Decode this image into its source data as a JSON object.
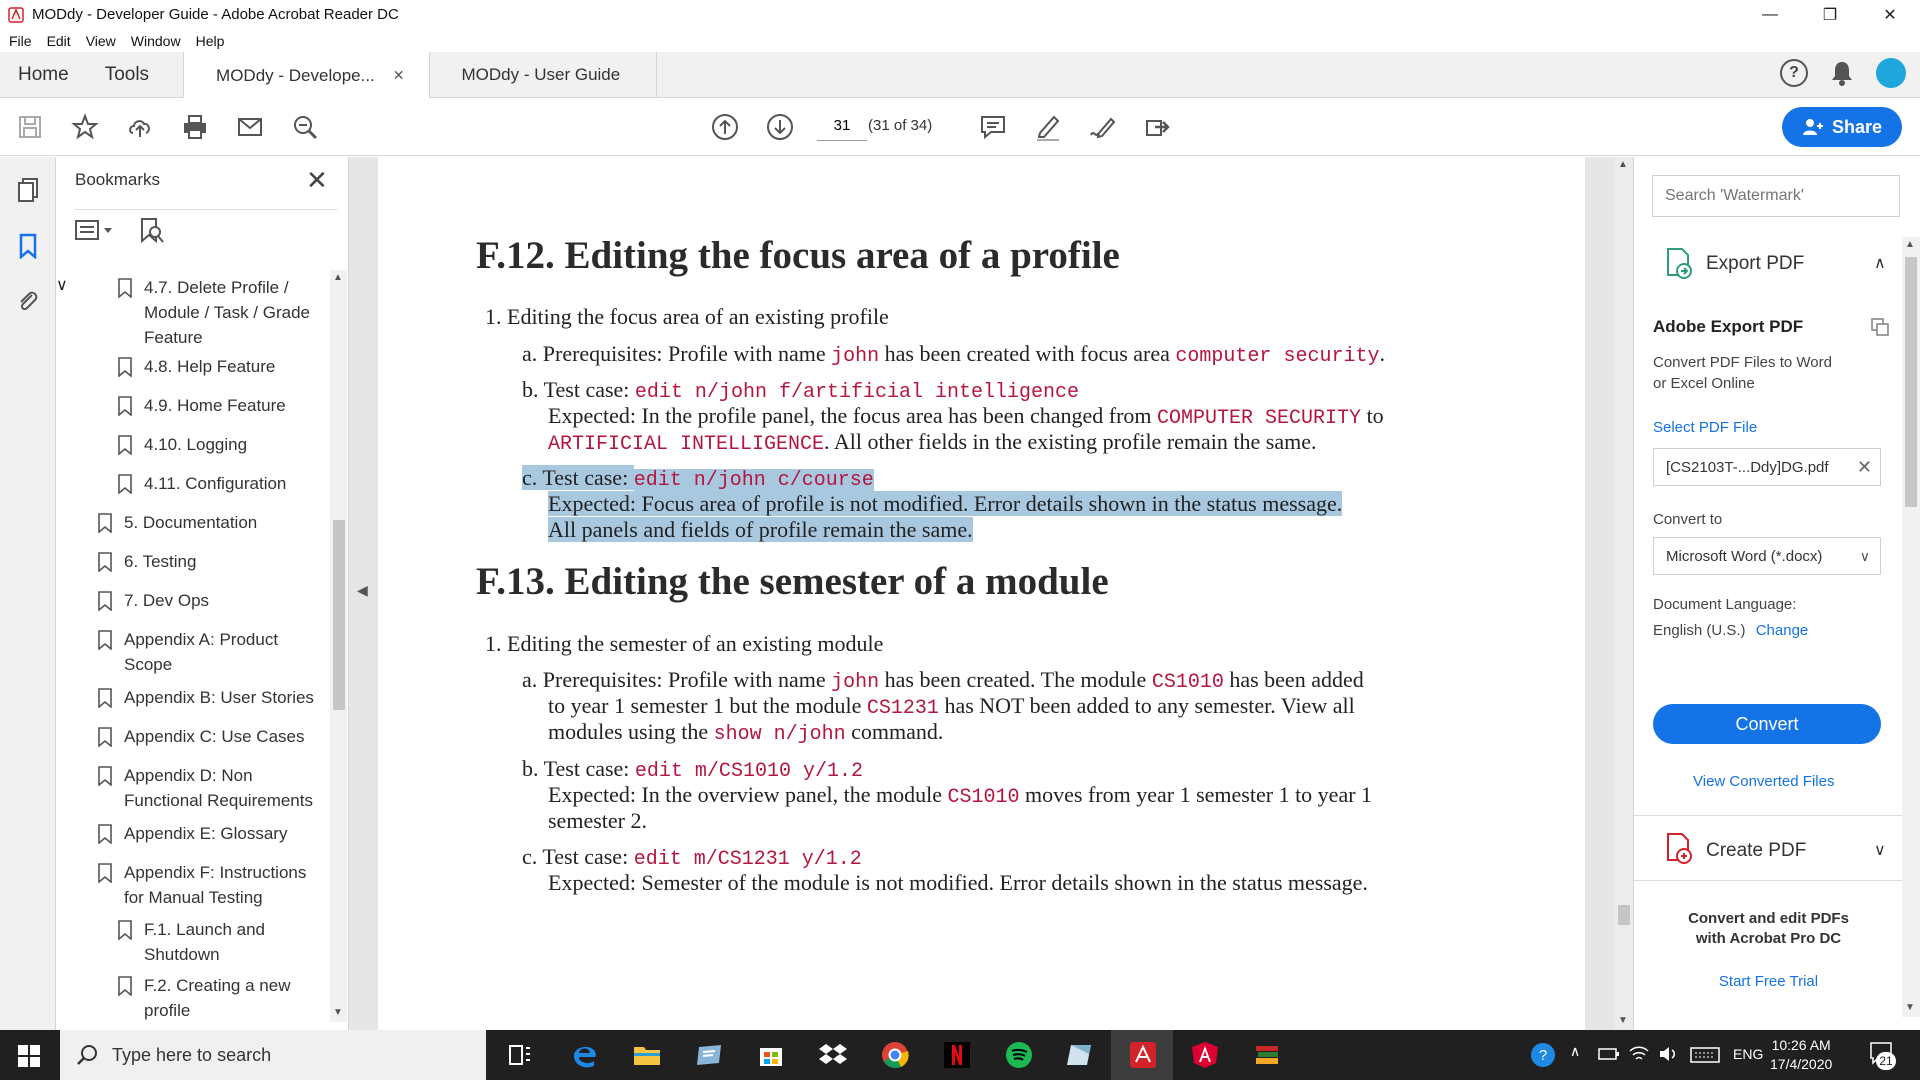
{
  "window": {
    "title": "MODdy - Developer Guide - Adobe Acrobat Reader DC"
  },
  "menu": {
    "items": [
      "File",
      "Edit",
      "View",
      "Window",
      "Help"
    ]
  },
  "tabs": {
    "home": "Home",
    "tools": "Tools",
    "doc_tabs": [
      {
        "label": "MODdy - Develope...",
        "active": true
      },
      {
        "label": "MODdy - User Guide",
        "active": false
      }
    ]
  },
  "toolbar": {
    "page_value": "31",
    "page_count": "(31 of 34)",
    "share_label": "Share"
  },
  "bookmarks": {
    "title": "Bookmarks",
    "items": [
      {
        "label": "4.7. Delete Profile / Module / Task / Grade Feature"
      },
      {
        "label": "4.8. Help Feature"
      },
      {
        "label": "4.9. Home Feature"
      },
      {
        "label": "4.10. Logging"
      },
      {
        "label": "4.11. Configuration"
      },
      {
        "label": "5. Documentation"
      },
      {
        "label": "6. Testing"
      },
      {
        "label": "7. Dev Ops"
      },
      {
        "label": "Appendix A: Product Scope"
      },
      {
        "label": "Appendix B: User Stories"
      },
      {
        "label": "Appendix C: Use Cases"
      },
      {
        "label": "Appendix D: Non Functional Requirements"
      },
      {
        "label": "Appendix E: Glossary"
      },
      {
        "label": "Appendix F: Instructions for Manual Testing"
      },
      {
        "label": "F.1. Launch and Shutdown"
      },
      {
        "label": "F.2. Creating a new profile"
      }
    ]
  },
  "doc": {
    "h_f12": "F.12. Editing the focus area of a profile",
    "f12_item1": "1. Editing the focus area of an existing profile",
    "f12_a_prefix": "a. Prerequisites: Profile with name ",
    "f12_a_code1": "john",
    "f12_a_mid": " has been created with focus area ",
    "f12_a_code2": "computer security",
    "f12_a_end": ".",
    "f12_b_prefix": "b. Test case: ",
    "f12_b_code": "edit n/john f/artificial intelligence",
    "f12_b_exp1": "Expected: In the profile panel, the focus area has been changed from ",
    "f12_b_code2": "COMPUTER SECURITY",
    "f12_b_exp1_end": " to",
    "f12_b_code3": "ARTIFICIAL INTELLIGENCE",
    "f12_b_exp2": ". All other fields in the existing profile remain the same.",
    "f12_c_prefix": "c.",
    "f12_c_text": " Test case: ",
    "f12_c_code": "edit n/john c/course",
    "f12_c_exp1": "Expected: Focus area of profile is not modified. Error details shown in the status message.",
    "f12_c_exp2": "All panels and fields of profile remain the same.",
    "h_f13": "F.13. Editing the semester of a module",
    "f13_item1": "1. Editing the semester of an existing module",
    "f13_a_prefix": "a. Prerequisites: Profile with name ",
    "f13_a_code1": "john",
    "f13_a_mid": " has been created. The module ",
    "f13_a_code2": "CS1010",
    "f13_a_end": " has been added",
    "f13_a_l2_pre": "to year 1 semester 1 but the module ",
    "f13_a_code3": "CS1231",
    "f13_a_l2_end": " has NOT been added to any semester. View all",
    "f13_a_l3_pre": "modules using the ",
    "f13_a_code4": "show n/john",
    "f13_a_l3_end": " command.",
    "f13_b_prefix": "b. Test case: ",
    "f13_b_code": "edit m/CS1010 y/1.2",
    "f13_b_exp1": "Expected: In the overview panel, the module ",
    "f13_b_code2": "CS1010",
    "f13_b_exp1_end": " moves from year 1 semester 1 to year 1",
    "f13_b_exp2": "semester 2.",
    "f13_c_prefix": "c. Test case: ",
    "f13_c_code": "edit m/CS1231 y/1.2",
    "f13_c_exp1": "Expected: Semester of the module is not modified. Error details shown in the status message."
  },
  "right_panel": {
    "search_placeholder": "Search 'Watermark'",
    "export_title": "Export PDF",
    "adobe_export_title": "Adobe Export PDF",
    "adobe_export_desc1": "Convert PDF Files to Word",
    "adobe_export_desc2": "or Excel Online",
    "select_pdf_label": "Select PDF File",
    "selected_file": "[CS2103T-...Ddy]DG.pdf",
    "convert_to_label": "Convert to",
    "convert_to_value": "Microsoft Word (*.docx)",
    "doc_language_label": "Document Language:",
    "doc_language_value": "English (U.S.)",
    "change_link": "Change",
    "convert_button": "Convert",
    "view_converted": "View Converted Files",
    "create_pdf_title": "Create PDF",
    "promo_line1": "Convert and edit PDFs",
    "promo_line2": "with Acrobat Pro DC",
    "trial_link": "Start Free Trial"
  },
  "taskbar": {
    "search_placeholder": "Type here to search",
    "lang": "ENG",
    "time": "10:26 AM",
    "date": "17/4/2020",
    "notification_count": "21"
  },
  "colors": {
    "accent": "#1473e6",
    "code": "#b5153f",
    "highlight": "#a8c8e0"
  }
}
